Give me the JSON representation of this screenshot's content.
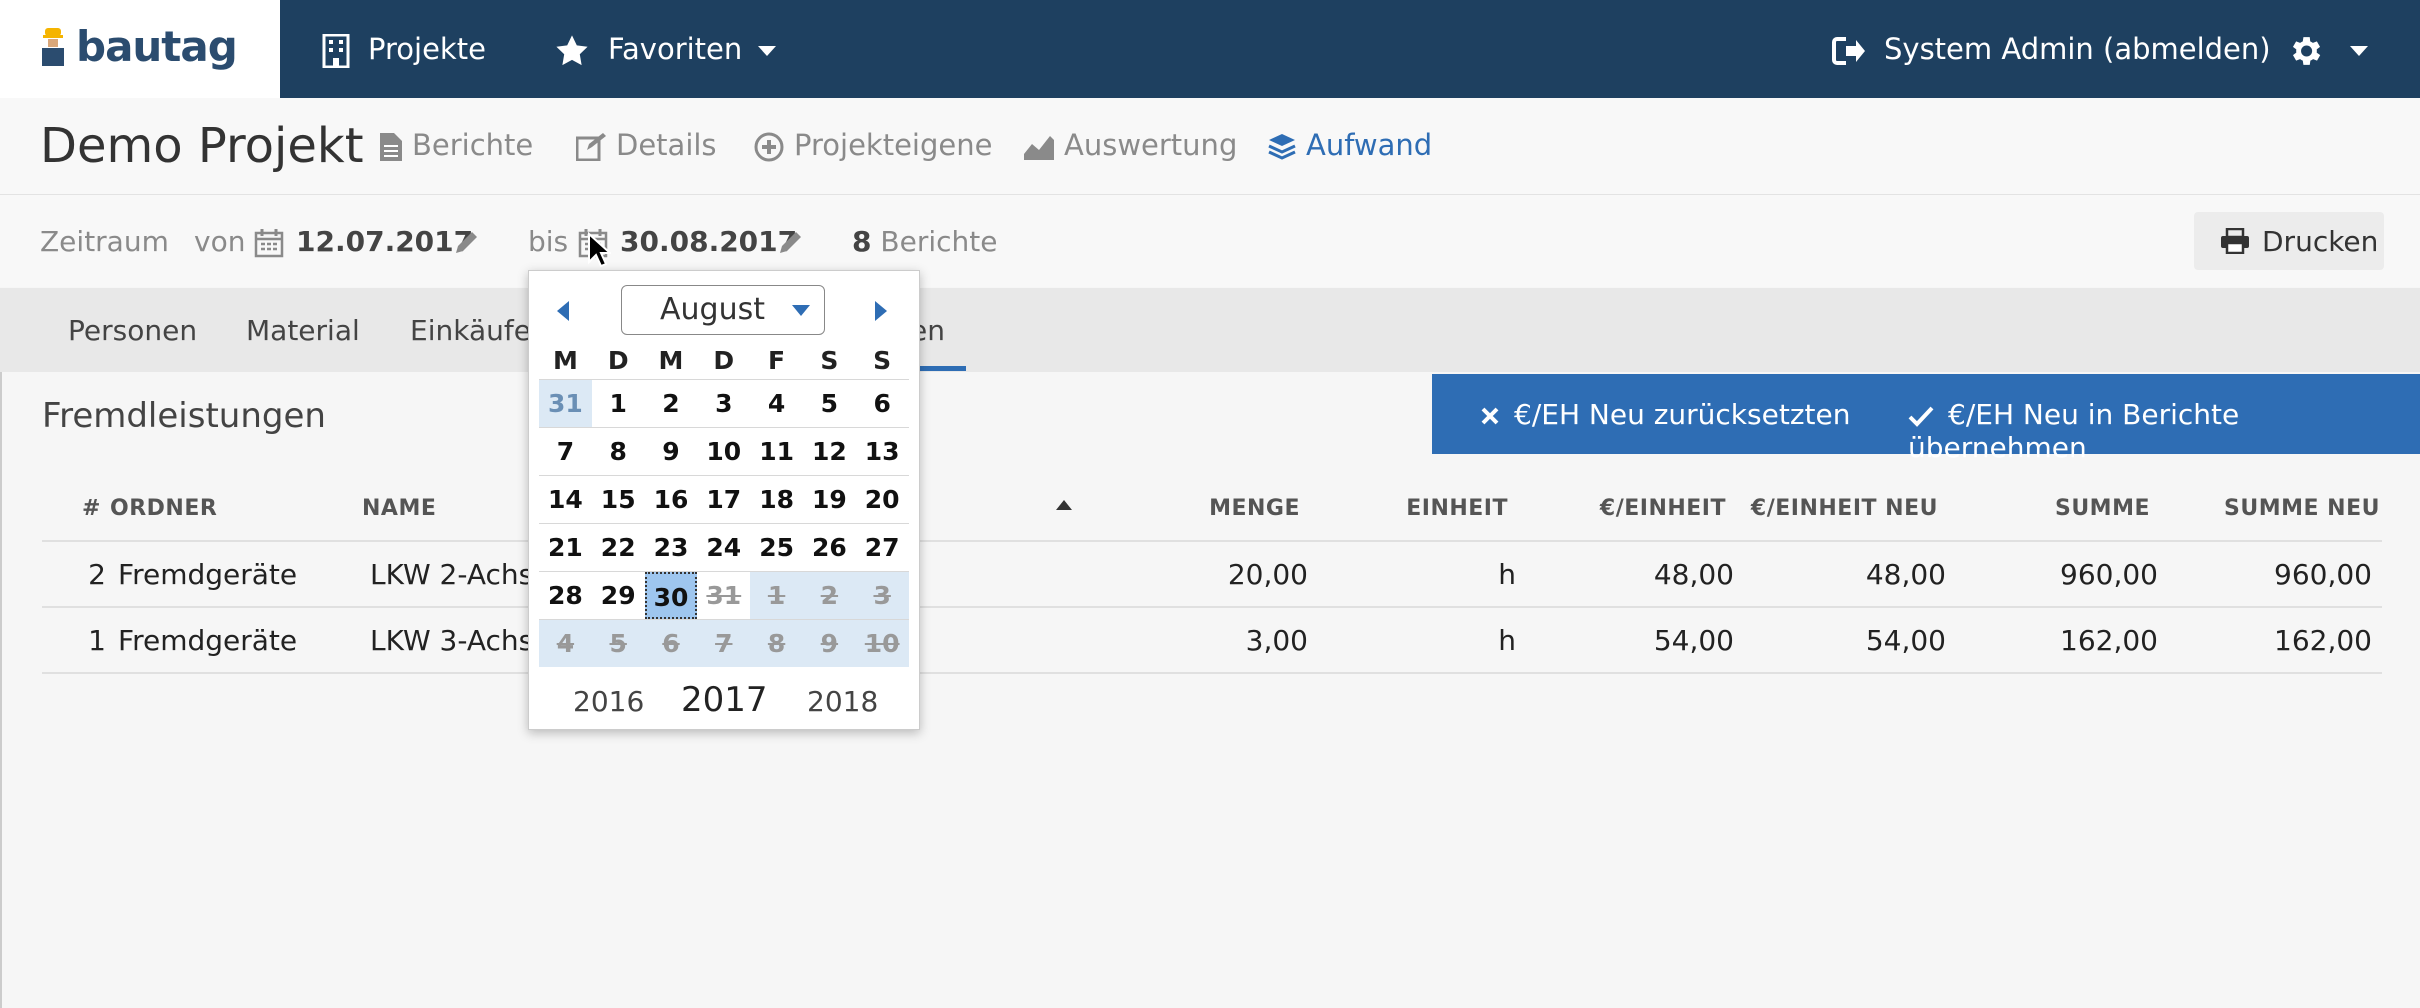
{
  "brand": {
    "name": "bautag"
  },
  "topnav": {
    "projects": "Projekte",
    "favorites": "Favoriten",
    "user": "System Admin (abmelden)"
  },
  "project": {
    "title": "Demo Projekt",
    "tabs": [
      {
        "label": "Berichte",
        "icon": "file-icon"
      },
      {
        "label": "Details",
        "icon": "edit-icon"
      },
      {
        "label": "Projekteigene",
        "icon": "plus-circle-icon"
      },
      {
        "label": "Auswertung",
        "icon": "area-chart-icon"
      },
      {
        "label": "Aufwand",
        "icon": "layers-icon",
        "active": true
      }
    ]
  },
  "filter": {
    "period_label": "Zeitraum",
    "from_label": "von",
    "from_date": "12.07.2017",
    "to_label": "bis",
    "to_date": "30.08.2017",
    "report_count": "8",
    "report_label": "Berichte",
    "print": "Drucken"
  },
  "categories": {
    "items": [
      "Personen",
      "Material",
      "Einkäufe"
    ],
    "active_partial": "en"
  },
  "section": {
    "title": "Fremdleistungen",
    "reset_btn": "€/EH Neu zurücksetzten",
    "apply_btn": "€/EH Neu in Berichte übernehmen"
  },
  "table": {
    "headers": {
      "num": "#",
      "ordner": "ORDNER",
      "name": "NAME",
      "menge": "MENGE",
      "einheit": "EINHEIT",
      "eur_einheit": "€/EINHEIT",
      "eur_einheit_neu": "€/EINHEIT NEU",
      "summe": "SUMME",
      "summe_neu": "SUMME NEU"
    },
    "rows": [
      {
        "num": "2",
        "ordner": "Fremdgeräte",
        "name": "LKW 2-Achs -",
        "menge": "20,00",
        "einheit": "h",
        "eur": "48,00",
        "eur_neu": "48,00",
        "summe": "960,00",
        "summe_neu": "960,00"
      },
      {
        "num": "1",
        "ordner": "Fremdgeräte",
        "name": "LKW 3-Achs -",
        "menge": "3,00",
        "einheit": "h",
        "eur": "54,00",
        "eur_neu": "54,00",
        "summe": "162,00",
        "summe_neu": "162,00"
      }
    ]
  },
  "datepicker": {
    "month": "August",
    "dow": [
      "M",
      "D",
      "M",
      "D",
      "F",
      "S",
      "S"
    ],
    "weeks": [
      [
        "31",
        "1",
        "2",
        "3",
        "4",
        "5",
        "6"
      ],
      [
        "7",
        "8",
        "9",
        "10",
        "11",
        "12",
        "13"
      ],
      [
        "14",
        "15",
        "16",
        "17",
        "18",
        "19",
        "20"
      ],
      [
        "21",
        "22",
        "23",
        "24",
        "25",
        "26",
        "27"
      ],
      [
        "28",
        "29",
        "30",
        "31",
        "1",
        "2",
        "3"
      ],
      [
        "4",
        "5",
        "6",
        "7",
        "8",
        "9",
        "10"
      ]
    ],
    "years": [
      "2016",
      "2017",
      "2018"
    ]
  }
}
